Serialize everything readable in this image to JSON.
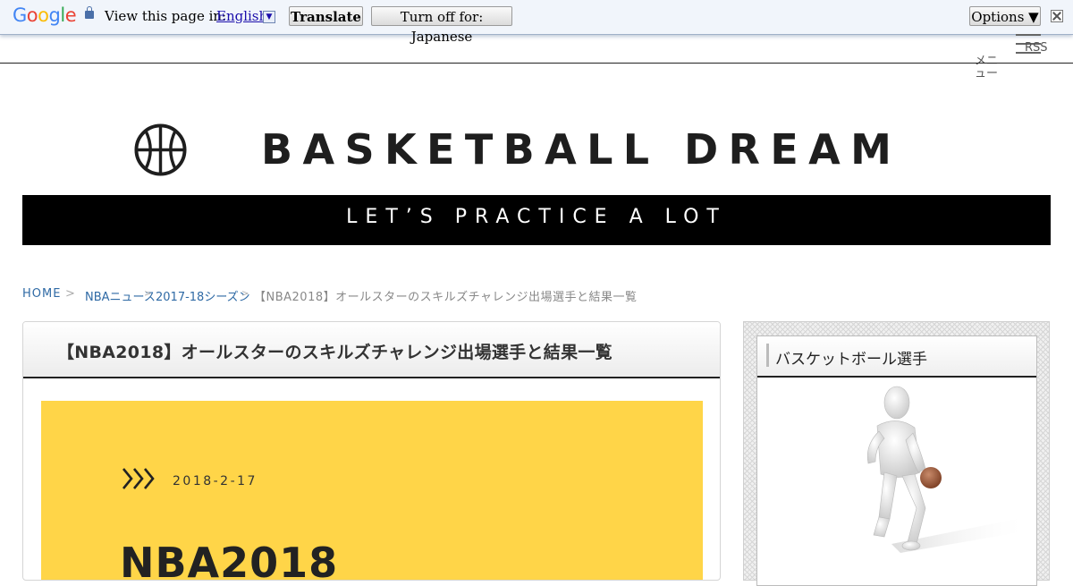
{
  "translate_bar": {
    "logo_text": "Google",
    "prompt": "View this page in:",
    "language": "English",
    "translate_label": "Translate",
    "turn_off_label": "Turn off for: Japanese",
    "options_label": "Options ▼",
    "google_colors": [
      "#4285F4",
      "#EA4335",
      "#FBBC05",
      "#4285F4",
      "#34A853",
      "#EA4335"
    ]
  },
  "header": {
    "rss_label": "RSS",
    "menu_label": "メニュー"
  },
  "logo": {
    "title": "BASKETBALL DREAM",
    "tagline": "LET’S PRACTICE A LOT"
  },
  "breadcrumb": {
    "items": [
      "HOME",
      "NBAニュース",
      "2017-18シーズン"
    ],
    "current": "【NBA2018】オールスターのスキルズチャレンジ出場選手と結果一覧"
  },
  "article": {
    "title": "【NBA2018】オールスターのスキルズチャレンジ出場選手と結果一覧",
    "hero_date": "2018-2-17",
    "hero_heading": "NBA2018",
    "hero_bg_color": "#ffd548"
  },
  "sidebar": {
    "widget_title": "バスケットボール選手"
  }
}
